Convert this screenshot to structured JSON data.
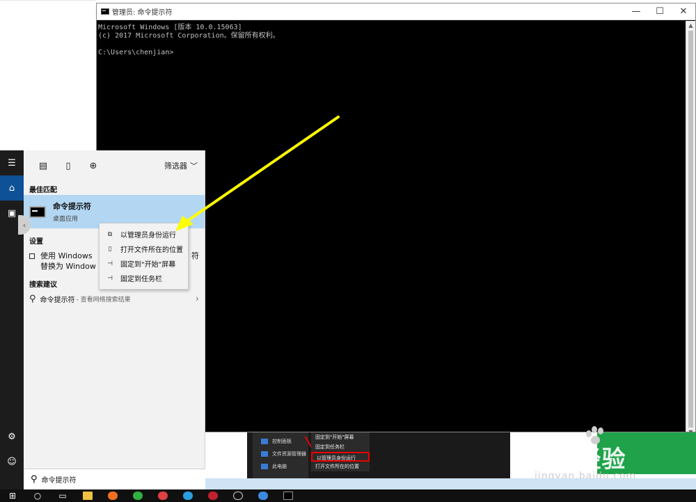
{
  "console": {
    "title": "管理员: 命令提示符",
    "lines": [
      "Microsoft Windows [版本 10.0.15063]",
      "(c) 2017 Microsoft Corporation。保留所有权利。",
      "",
      "C:\\Users\\chenjian>"
    ],
    "controls": {
      "minimize": "—",
      "maximize": "☐",
      "close": "✕"
    }
  },
  "start_menu": {
    "filter_label": "筛选器",
    "best_match_header": "最佳匹配",
    "best_match": {
      "name": "命令提示符",
      "type": "桌面应用"
    },
    "settings_header": "设置",
    "setting_item": {
      "text": "使用 Windows PowerShell 替换命令提示符 替换为 Windows",
      "visible_left": "使用 Windows",
      "visible_right": "符",
      "line2": "替换为 Window"
    },
    "suggestions_header": "搜索建议",
    "suggestion": {
      "main": "命令提示符",
      "sub": "- 查看网络搜索结果"
    },
    "search_value": "命令提示符"
  },
  "context_menu": {
    "items": [
      {
        "label": "以管理员身份运行",
        "icon": "shield-run-icon"
      },
      {
        "label": "打开文件所在的位置",
        "icon": "folder-open-icon"
      },
      {
        "label": "固定到\"开始\"屏幕",
        "icon": "pin-icon"
      },
      {
        "label": "固定到任务栏",
        "icon": "pin-icon"
      }
    ]
  },
  "inset_screenshot": {
    "sidebar": [
      "控制面板",
      "文件资源管理器",
      "此电脑"
    ],
    "menu": [
      "固定到\"开始\"屏幕",
      "固定到任务栏",
      "以管理员身份运行",
      "打开文件所在的位置"
    ]
  },
  "watermark": {
    "brand": "Bai经验",
    "url": "jingyan.baidu.com"
  },
  "colors": {
    "accent": "#0f5196",
    "selection": "#b3d7f3",
    "arrow": "#ffff00",
    "green": "#1fa24a"
  }
}
